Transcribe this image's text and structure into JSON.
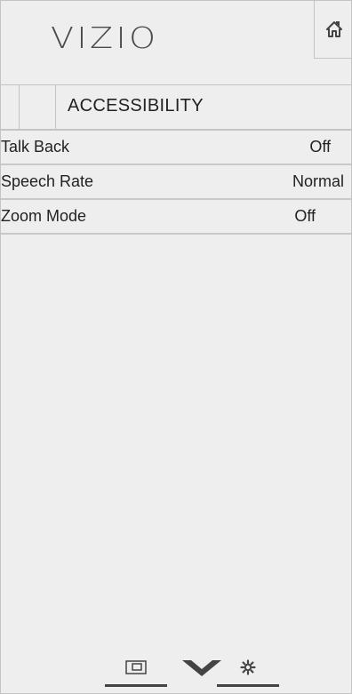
{
  "header": {
    "logo_text": "VIZIO",
    "home_icon": "home-icon"
  },
  "title_bar": {
    "title": "ACCESSIBILITY"
  },
  "menu": {
    "items": [
      {
        "label": "Talk Back",
        "value": "Off"
      },
      {
        "label": "Speech Rate",
        "value": "Normal"
      },
      {
        "label": "Zoom Mode",
        "value": "Off"
      }
    ]
  },
  "bottom_nav": {
    "icons": [
      "input-icon",
      "vizio-v-icon",
      "settings-gear-icon"
    ]
  },
  "colors": {
    "background": "#eeeeee",
    "divider": "#c4c4c4",
    "text": "#222222",
    "icon": "#444444"
  }
}
